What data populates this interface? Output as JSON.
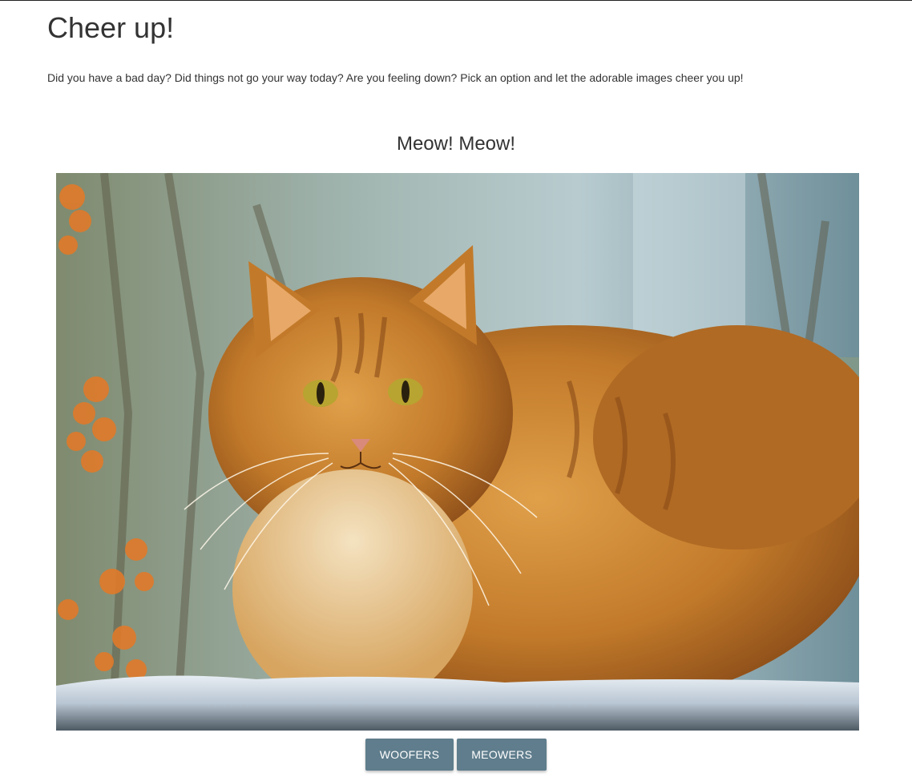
{
  "page": {
    "title": "Cheer up!",
    "intro": "Did you have a bad day? Did things not go your way today? Are you feeling down? Pick an option and let the adorable images cheer you up!"
  },
  "section": {
    "title": "Meow! Meow!"
  },
  "photo": {
    "subject": "orange long-haired cat lying on snow"
  },
  "buttons": {
    "woofers": "WOOFERS",
    "meowers": "MEOWERS"
  },
  "colors": {
    "button_bg": "#5f7d8c",
    "button_text": "#ffffff",
    "text": "#333333"
  }
}
